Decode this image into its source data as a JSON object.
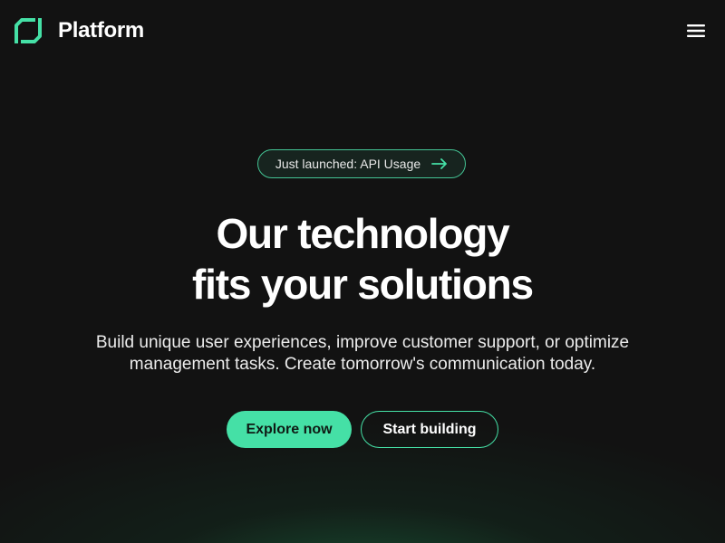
{
  "header": {
    "brand": "Platform",
    "logo_icon": "platform-logo-icon",
    "menu_icon": "hamburger-menu-icon"
  },
  "hero": {
    "announcement": "Just launched: API Usage",
    "announcement_icon": "arrow-right-icon",
    "headline_line1": "Our technology",
    "headline_line2": "fits your solutions",
    "subtitle_line1": "Build unique user experiences, improve customer support, or optimize",
    "subtitle_line2": "management tasks. Create tomorrow's communication today.",
    "primary_cta": "Explore now",
    "secondary_cta": "Start building"
  },
  "colors": {
    "background": "#121212",
    "accent": "#45e0a6",
    "text": "#ffffff"
  }
}
